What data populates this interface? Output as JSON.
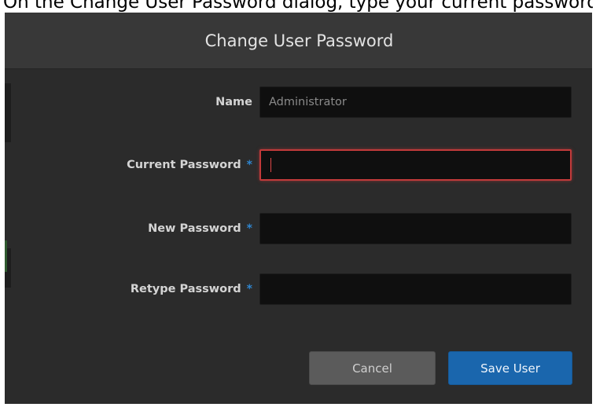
{
  "caption": {
    "text": "On the Change User Password dialog, type your current password."
  },
  "dialog": {
    "title": "Change User Password",
    "fields": {
      "name": {
        "label": "Name",
        "value": "Administrator"
      },
      "current_password": {
        "label": "Current Password",
        "required_mark": "*",
        "value": ""
      },
      "new_password": {
        "label": "New Password",
        "required_mark": "*",
        "value": ""
      },
      "retype_password": {
        "label": "Retype Password",
        "required_mark": "*",
        "value": ""
      }
    },
    "buttons": {
      "cancel_label": "Cancel",
      "save_label": "Save User"
    }
  },
  "colors": {
    "dialog_bg": "#2b2b2b",
    "header_bg": "#383838",
    "input_bg": "#0f0f0f",
    "focus_border": "#c23a3a",
    "required_mark": "#2f86d0",
    "save_button": "#1a66ad",
    "cancel_button": "#5b5b5b"
  }
}
